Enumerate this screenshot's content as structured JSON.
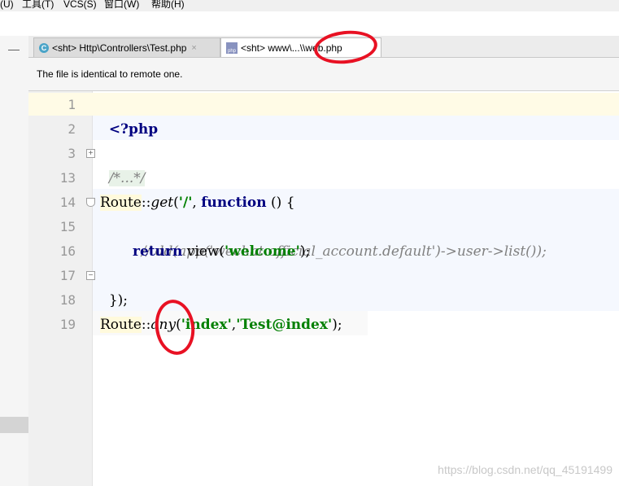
{
  "menu": [
    "(U)",
    "工具(T)",
    "VCS(S)",
    "窗口(W)",
    "帮助(H)"
  ],
  "tabs": [
    {
      "label": "<sht> Http\\Controllers\\Test.php",
      "close": "×"
    },
    {
      "label": "<sht> www\\...\\",
      "suffix": "\\web.php"
    }
  ],
  "notification": "The file is identical to remote one.",
  "line_numbers": [
    "1",
    "2",
    "3",
    "13",
    "14",
    "15",
    "16",
    "17",
    "18",
    "19"
  ],
  "code": {
    "l1": "<?php",
    "l3": "/*...*/",
    "l14_route": "Route",
    "l14_sep": "::",
    "l14_fn": "get",
    "l14_open": "(",
    "l14_str": "'/'",
    "l14_comma": ", ",
    "l14_kw": "function",
    "l14_rest": " () {",
    "l15": "// dd(app('wechat.official_account.default')->user->list());",
    "l16_kw": "return",
    "l16_fn": " view(",
    "l16_str": "'welcome'",
    "l16_rest": ");",
    "l17": "});",
    "l19_route": "Route",
    "l19_sep": "::",
    "l19_fn": "any",
    "l19_open": "(",
    "l19_str1": "'index'",
    "l19_comma": ",",
    "l19_str2": "'Test@index'",
    "l19_rest": ");"
  },
  "watermark": "https://blog.csdn.net/qq_45191499",
  "colors": {
    "annotation": "#e81123",
    "keyword": "#000080",
    "string": "#008000"
  }
}
